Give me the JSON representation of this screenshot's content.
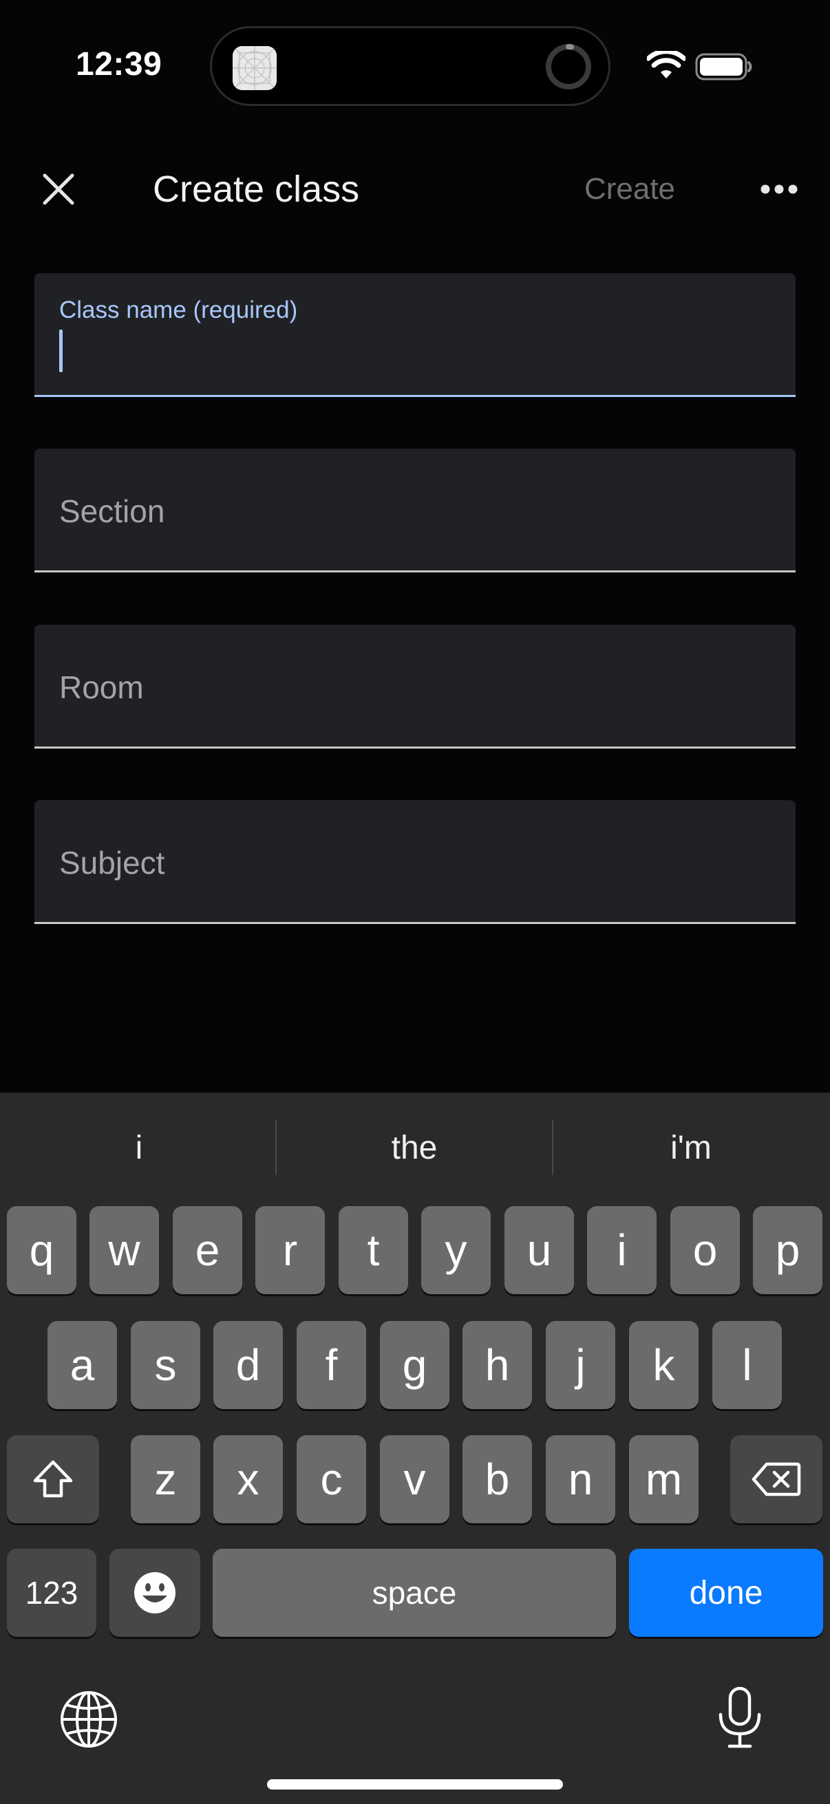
{
  "status_bar": {
    "time": "12:39",
    "icons": [
      "app-icon",
      "spinner-icon",
      "wifi-icon",
      "battery-icon"
    ]
  },
  "app_bar": {
    "close_icon": "close-icon",
    "title": "Create class",
    "create_label": "Create",
    "more_icon": "more-horizontal-icon"
  },
  "form": {
    "class_name": {
      "label": "Class name (required)",
      "value": ""
    },
    "section": {
      "placeholder": "Section"
    },
    "room": {
      "placeholder": "Room"
    },
    "subject": {
      "placeholder": "Subject"
    }
  },
  "keyboard": {
    "suggestions": [
      "i",
      "the",
      "i'm"
    ],
    "row1": [
      "q",
      "w",
      "e",
      "r",
      "t",
      "y",
      "u",
      "i",
      "o",
      "p"
    ],
    "row2": [
      "a",
      "s",
      "d",
      "f",
      "g",
      "h",
      "j",
      "k",
      "l"
    ],
    "row3": [
      "z",
      "x",
      "c",
      "v",
      "b",
      "n",
      "m"
    ],
    "numbers_label": "123",
    "space_label": "space",
    "done_label": "done",
    "icons": [
      "shift-icon",
      "backspace-icon",
      "emoji-icon",
      "globe-icon",
      "microphone-icon"
    ]
  },
  "colors": {
    "background": "#050505",
    "field_background": "#202124",
    "focus_accent": "#a8c7fa",
    "done_key": "#0a7aff"
  }
}
